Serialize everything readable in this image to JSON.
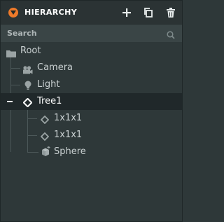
{
  "header": {
    "title": "HIERARCHY",
    "accent_color": "#ee7a2a",
    "icons": {
      "panel": "chevron-down-circle-icon",
      "add": "plus-icon",
      "duplicate": "copy-icon",
      "delete": "trash-icon"
    }
  },
  "search": {
    "placeholder": "Search",
    "value": "",
    "icon": "magnifier-icon"
  },
  "tree": {
    "root_label": "Root",
    "items": [
      {
        "label": "Camera",
        "icon": "camera-entity-icon"
      },
      {
        "label": "Light",
        "icon": "light-bulb-icon"
      },
      {
        "label": "Tree1",
        "icon": "diamond-entity-icon",
        "selected": true,
        "expanded": true
      },
      {
        "label": "1x1x1",
        "icon": "diamond-entity-icon"
      },
      {
        "label": "1x1x1",
        "icon": "diamond-entity-icon"
      },
      {
        "label": "Sphere",
        "icon": "cube-model-icon"
      }
    ]
  }
}
